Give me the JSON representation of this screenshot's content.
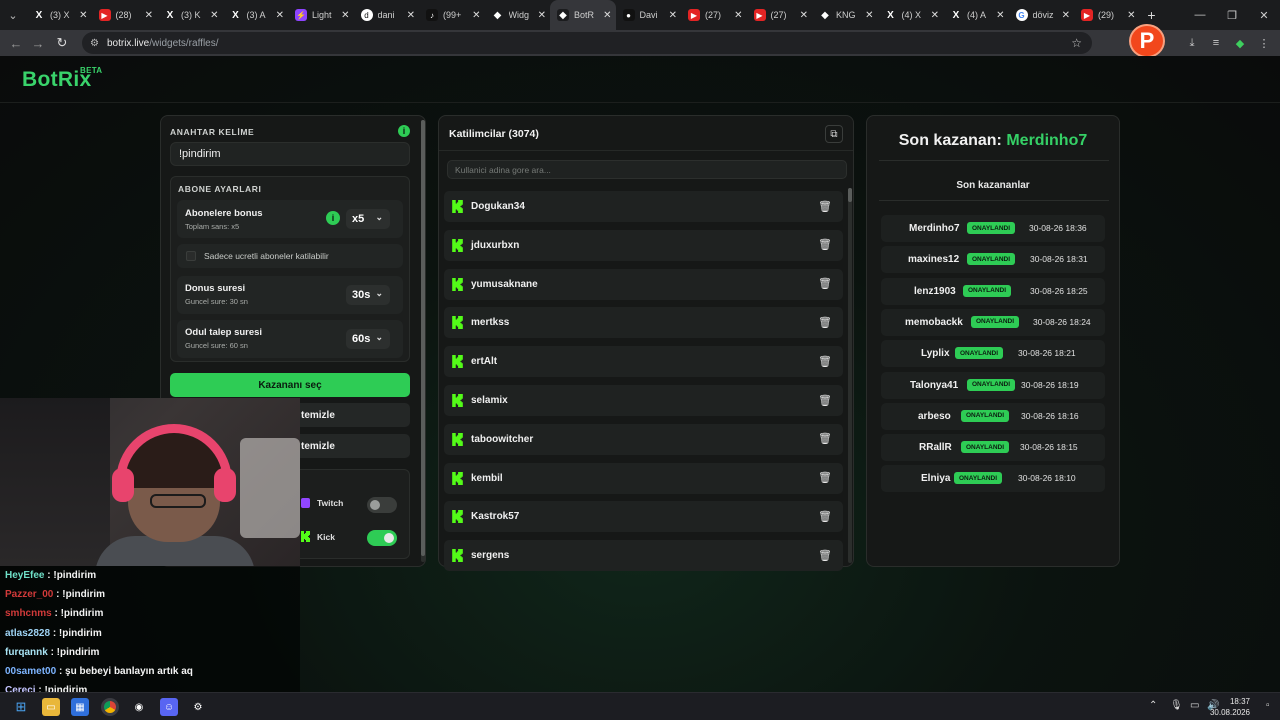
{
  "browser": {
    "tabs": [
      {
        "icon": "x-logo-icon",
        "label": "(3) X"
      },
      {
        "icon": "youtube-icon",
        "label": "(28)"
      },
      {
        "icon": "x-logo-icon",
        "label": "(3) K"
      },
      {
        "icon": "x-logo-icon",
        "label": "(3) A"
      },
      {
        "icon": "lightning-icon",
        "label": "Light"
      },
      {
        "icon": "dm-icon",
        "label": "dani"
      },
      {
        "icon": "tiktok-icon",
        "label": "(99+"
      },
      {
        "icon": "botrix-icon",
        "label": "Widg"
      },
      {
        "icon": "botrix-icon",
        "label": "BotR"
      },
      {
        "icon": "pokemon-icon",
        "label": "Davi"
      },
      {
        "icon": "youtube-icon",
        "label": "(27)"
      },
      {
        "icon": "youtube-icon",
        "label": "(27)"
      },
      {
        "icon": "botrix-icon",
        "label": "KNG"
      },
      {
        "icon": "x-logo-icon",
        "label": "(4) X"
      },
      {
        "icon": "x-logo-icon",
        "label": "(4) A"
      },
      {
        "icon": "google-icon",
        "label": "döviz"
      },
      {
        "icon": "youtube-icon",
        "label": "(29)"
      }
    ],
    "active_tab_index": 8,
    "url_host": "botrix.live",
    "url_path": "/widgets/raffles/",
    "profile_letter": "P"
  },
  "app": {
    "logo": "BotRix",
    "logo_badge": "BETA"
  },
  "settings": {
    "keyword_label": "ANAHTAR KELİME",
    "keyword_value": "!pindirim",
    "sub_settings_label": "ABONE AYARLARI",
    "sub_bonus_title": "Abonelere bonus",
    "sub_bonus_sub": "Toplam sans: x5",
    "sub_bonus_value": "x5",
    "only_paid_label": "Sadece ucretli aboneler katilabilir",
    "spin_title": "Donus suresi",
    "spin_sub": "Guncel sure: 30 sn",
    "spin_value": "30s",
    "claim_title": "Odul talep suresi",
    "claim_sub": "Guncel sure: 60 sn",
    "claim_value": "60s",
    "pick_winner": "Kazananı seç",
    "clear_1": "temizle",
    "clear_2": "temizle",
    "twitch_label": "Twitch",
    "kick_label": "Kick",
    "twitch_on": false,
    "kick_on": true
  },
  "participants": {
    "title": "Katilimcilar (3074)",
    "search_placeholder": "Kullanici adina gore ara...",
    "items": [
      "Dogukan34",
      "jduxurbxn",
      "yumusaknane",
      "mertkss",
      "ertAlt",
      "selamix",
      "taboowitcher",
      "kembil",
      "Kastrok57",
      "sergens"
    ]
  },
  "winners": {
    "last_winner_prefix": "Son kazanan:",
    "last_winner_name": "Merdinho7",
    "list_title": "Son kazananlar",
    "badge": "ONAYLANDI",
    "items": [
      {
        "name": "Merdinho7",
        "date": "30-08-26 18:36"
      },
      {
        "name": "maxines12",
        "date": "30-08-26 18:31"
      },
      {
        "name": "lenz1903",
        "date": "30-08-26 18:25"
      },
      {
        "name": "memobackk",
        "date": "30-08-26 18:24"
      },
      {
        "name": "Lyplix",
        "date": "30-08-26 18:21"
      },
      {
        "name": "Talonya41",
        "date": "30-08-26 18:19"
      },
      {
        "name": "arbeso",
        "date": "30-08-26 18:16"
      },
      {
        "name": "RRallR",
        "date": "30-08-26 18:15"
      },
      {
        "name": "Elniya",
        "date": "30-08-26 18:10"
      }
    ]
  },
  "chat": [
    {
      "user": "HeyEfee",
      "color": "#6fe0c8",
      "msg": ": !pindirim"
    },
    {
      "user": "Pazzer_00",
      "color": "#d23a3a",
      "msg": ": !pindirim"
    },
    {
      "user": "smhcnms",
      "color": "#d23a3a",
      "msg": ": !pindirim"
    },
    {
      "user": "atlas2828",
      "color": "#9fd4f5",
      "msg": ": !pindirim"
    },
    {
      "user": "furqannk",
      "color": "#a9e3f3",
      "msg": ": !pindirim"
    },
    {
      "user": "00samet00",
      "color": "#7db4ff",
      "msg": ": şu bebeyi banlayın artık aq"
    },
    {
      "user": "Cereci",
      "color": "#c4c4ff",
      "msg": ": !pindirim"
    }
  ],
  "taskbar": {
    "time": "18:37",
    "date": "30.08.2026"
  },
  "colors": {
    "accent": "#2ecc55",
    "kick_green": "#53fc18",
    "profile": "#f2471c"
  }
}
